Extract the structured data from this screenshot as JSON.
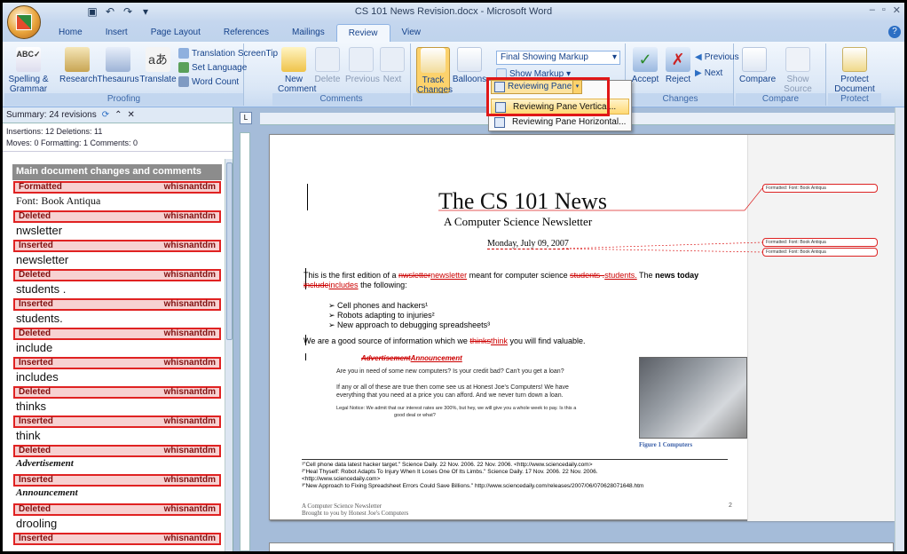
{
  "window": {
    "title": "CS 101 News Revision.docx - Microsoft Word"
  },
  "tabs": [
    "Home",
    "Insert",
    "Page Layout",
    "References",
    "Mailings",
    "Review",
    "View"
  ],
  "active_tab": "Review",
  "ribbon": {
    "proofing": {
      "label": "Proofing",
      "spelling": "Spelling & Grammar",
      "research": "Research",
      "thesaurus": "Thesaurus",
      "translate": "Translate",
      "screentip": "Translation ScreenTip",
      "set_language": "Set Language",
      "word_count": "Word Count"
    },
    "comments": {
      "label": "Comments",
      "new": "New Comment",
      "delete": "Delete",
      "previous": "Previous",
      "next": "Next"
    },
    "tracking": {
      "label": "Tracking",
      "track_changes": "Track Changes",
      "balloons": "Balloons",
      "display_combo": "Final Showing Markup",
      "show_markup": "Show Markup",
      "reviewing_pane": "Reviewing Pane"
    },
    "changes": {
      "label": "Changes",
      "accept": "Accept",
      "reject": "Reject",
      "previous": "Previous",
      "next": "Next"
    },
    "compare": {
      "label": "Compare",
      "compare": "Compare",
      "show_source": "Show Source Documents"
    },
    "protect": {
      "label": "Protect",
      "protect_doc": "Protect Document"
    }
  },
  "menu": {
    "items": [
      "Reviewing Pane Vertical...",
      "Reviewing Pane Horizontal..."
    ],
    "highlighted": 0
  },
  "reviewing_pane": {
    "summary": "Summary: 24 revisions",
    "counts_line1": "Insertions: 12  Deletions: 11",
    "counts_line2": "Moves: 0  Formatting: 1  Comments: 0",
    "section_header": "Main document changes and comments",
    "revisions": [
      {
        "type": "Formatted",
        "author": "whisnantdm",
        "text": "Font: Book Antiqua",
        "style": "serif"
      },
      {
        "type": "Deleted",
        "author": "whisnantdm",
        "text": "nwsletter",
        "style": ""
      },
      {
        "type": "Inserted",
        "author": "whisnantdm",
        "text": "newsletter",
        "style": ""
      },
      {
        "type": "Deleted",
        "author": "whisnantdm",
        "text": "students  .",
        "style": ""
      },
      {
        "type": "Inserted",
        "author": "whisnantdm",
        "text": "students.",
        "style": ""
      },
      {
        "type": "Deleted",
        "author": "whisnantdm",
        "text": "include",
        "style": ""
      },
      {
        "type": "Inserted",
        "author": "whisnantdm",
        "text": "includes",
        "style": ""
      },
      {
        "type": "Deleted",
        "author": "whisnantdm",
        "text": "thinks",
        "style": ""
      },
      {
        "type": "Inserted",
        "author": "whisnantdm",
        "text": "think",
        "style": ""
      },
      {
        "type": "Deleted",
        "author": "whisnantdm",
        "text": "Advertisement",
        "style": "bi"
      },
      {
        "type": "Inserted",
        "author": "whisnantdm",
        "text": "Announcement",
        "style": "bi"
      },
      {
        "type": "Deleted",
        "author": "whisnantdm",
        "text": "drooling",
        "style": ""
      },
      {
        "type": "Inserted",
        "author": "whisnantdm",
        "text": "",
        "style": ""
      }
    ]
  },
  "document": {
    "title": "The CS 101 News",
    "subtitle": "A Computer Science Newsletter",
    "date": "Monday, July 09, 2007",
    "para1_a": "This is the first edition of a ",
    "para1_del1": "nwsletter",
    "para1_ins1": "newsletter",
    "para1_b": " meant for computer science ",
    "para1_del2": "students  .",
    "para1_ins2": "students.",
    "para1_c": " The ",
    "para1_bold": "news today",
    "para1_del3": "include",
    "para1_ins3": "includes",
    "para1_d": " the following:",
    "bullets": [
      "Cell phones and hackers¹",
      "Robots adapting to injuries²",
      "New approach to debugging spreadsheets³"
    ],
    "para2_a": "We are a good source of information which we ",
    "para2_del": "thinks",
    "para2_ins": "think",
    "para2_b": " you will find valuable.",
    "adv_del": "Advertisement",
    "adv_ins": "Announcement",
    "adv_line1": "Are you in need of some new computers? Is your credit bad? Can't you get a loan?",
    "adv_line2a": "If any or all of these are true then come see us at Honest Joe's Computers! We have",
    "adv_line2b": "everything that you need at a price you can afford. And we never turn down a loan.",
    "legal_a": "Legal Notice: We admit that our interest rates are 300%, but hey, we will give you a whole week to pay. Is this a",
    "legal_b": "good deal or what?",
    "figure_caption": "Figure 1 Computers",
    "footnote1": "¹\"Cell phone data latest hacker target.\" Science Daily. 22 Nov. 2006. 22 Nov. 2006. <http://www.sciencedaily.com>",
    "footnote2": "²\"Heal Thyself: Robot Adapts To Injury When It Loses One Of Its Limbs.\" Science Daily. 17 Nov. 2006. 22 Nov. 2006.",
    "footnote2b": "<http://www.sciencedaily.com>",
    "footnote3": "³\"New Approach to Fixing Spreadsheet Errors Could Save Billions.\"  http://www.sciencedaily.com/releases/2007/06/070628071648.htm",
    "footer1": "A Computer Science Newsletter",
    "footer2": "Brought to you by Honest Joe's Computers",
    "page_number": "2",
    "balloons": [
      "Formatted: Font: Book Antiqua",
      "Formatted: Font: Book Antiqua",
      "Formatted: Font: Book Antiqua"
    ]
  },
  "colors": {
    "deleted_border": "#e02222",
    "ribbon_bg": "#dbe7f6",
    "accent": "#15428b"
  }
}
